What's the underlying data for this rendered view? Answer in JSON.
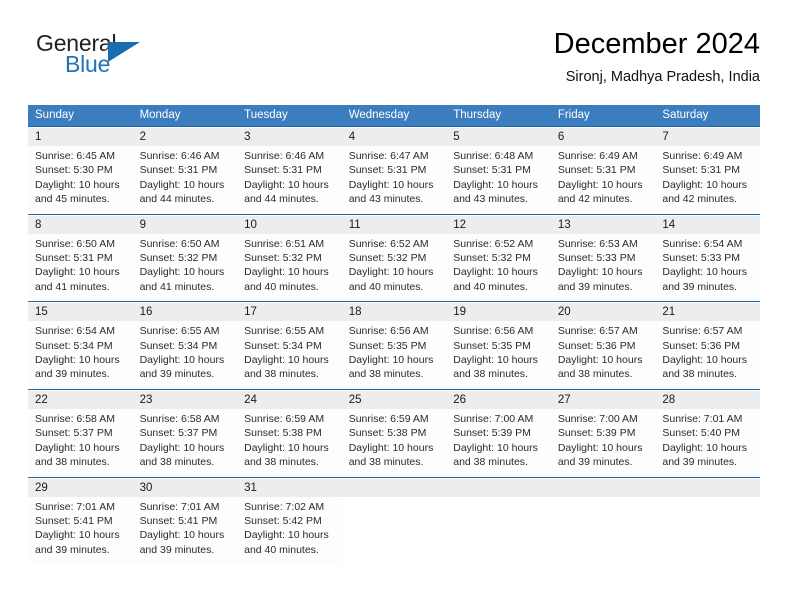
{
  "brand": {
    "line1": "General",
    "line2": "Blue",
    "triangle_color": "#1a6cb0"
  },
  "header": {
    "title": "December 2024",
    "location": "Sironj, Madhya Pradesh, India"
  },
  "theme": {
    "header_bg": "#3b7dbf",
    "separator": "#1d66aa",
    "daynum_bg": "#ededed"
  },
  "weekdays": [
    "Sunday",
    "Monday",
    "Tuesday",
    "Wednesday",
    "Thursday",
    "Friday",
    "Saturday"
  ],
  "labels": {
    "sunrise": "Sunrise:",
    "sunset": "Sunset:",
    "daylight": "Daylight:"
  },
  "weeks": [
    [
      {
        "day": "1",
        "sunrise": "Sunrise: 6:45 AM",
        "sunset": "Sunset: 5:30 PM",
        "daylight": "Daylight: 10 hours and 45 minutes."
      },
      {
        "day": "2",
        "sunrise": "Sunrise: 6:46 AM",
        "sunset": "Sunset: 5:31 PM",
        "daylight": "Daylight: 10 hours and 44 minutes."
      },
      {
        "day": "3",
        "sunrise": "Sunrise: 6:46 AM",
        "sunset": "Sunset: 5:31 PM",
        "daylight": "Daylight: 10 hours and 44 minutes."
      },
      {
        "day": "4",
        "sunrise": "Sunrise: 6:47 AM",
        "sunset": "Sunset: 5:31 PM",
        "daylight": "Daylight: 10 hours and 43 minutes."
      },
      {
        "day": "5",
        "sunrise": "Sunrise: 6:48 AM",
        "sunset": "Sunset: 5:31 PM",
        "daylight": "Daylight: 10 hours and 43 minutes."
      },
      {
        "day": "6",
        "sunrise": "Sunrise: 6:49 AM",
        "sunset": "Sunset: 5:31 PM",
        "daylight": "Daylight: 10 hours and 42 minutes."
      },
      {
        "day": "7",
        "sunrise": "Sunrise: 6:49 AM",
        "sunset": "Sunset: 5:31 PM",
        "daylight": "Daylight: 10 hours and 42 minutes."
      }
    ],
    [
      {
        "day": "8",
        "sunrise": "Sunrise: 6:50 AM",
        "sunset": "Sunset: 5:31 PM",
        "daylight": "Daylight: 10 hours and 41 minutes."
      },
      {
        "day": "9",
        "sunrise": "Sunrise: 6:50 AM",
        "sunset": "Sunset: 5:32 PM",
        "daylight": "Daylight: 10 hours and 41 minutes."
      },
      {
        "day": "10",
        "sunrise": "Sunrise: 6:51 AM",
        "sunset": "Sunset: 5:32 PM",
        "daylight": "Daylight: 10 hours and 40 minutes."
      },
      {
        "day": "11",
        "sunrise": "Sunrise: 6:52 AM",
        "sunset": "Sunset: 5:32 PM",
        "daylight": "Daylight: 10 hours and 40 minutes."
      },
      {
        "day": "12",
        "sunrise": "Sunrise: 6:52 AM",
        "sunset": "Sunset: 5:32 PM",
        "daylight": "Daylight: 10 hours and 40 minutes."
      },
      {
        "day": "13",
        "sunrise": "Sunrise: 6:53 AM",
        "sunset": "Sunset: 5:33 PM",
        "daylight": "Daylight: 10 hours and 39 minutes."
      },
      {
        "day": "14",
        "sunrise": "Sunrise: 6:54 AM",
        "sunset": "Sunset: 5:33 PM",
        "daylight": "Daylight: 10 hours and 39 minutes."
      }
    ],
    [
      {
        "day": "15",
        "sunrise": "Sunrise: 6:54 AM",
        "sunset": "Sunset: 5:34 PM",
        "daylight": "Daylight: 10 hours and 39 minutes."
      },
      {
        "day": "16",
        "sunrise": "Sunrise: 6:55 AM",
        "sunset": "Sunset: 5:34 PM",
        "daylight": "Daylight: 10 hours and 39 minutes."
      },
      {
        "day": "17",
        "sunrise": "Sunrise: 6:55 AM",
        "sunset": "Sunset: 5:34 PM",
        "daylight": "Daylight: 10 hours and 38 minutes."
      },
      {
        "day": "18",
        "sunrise": "Sunrise: 6:56 AM",
        "sunset": "Sunset: 5:35 PM",
        "daylight": "Daylight: 10 hours and 38 minutes."
      },
      {
        "day": "19",
        "sunrise": "Sunrise: 6:56 AM",
        "sunset": "Sunset: 5:35 PM",
        "daylight": "Daylight: 10 hours and 38 minutes."
      },
      {
        "day": "20",
        "sunrise": "Sunrise: 6:57 AM",
        "sunset": "Sunset: 5:36 PM",
        "daylight": "Daylight: 10 hours and 38 minutes."
      },
      {
        "day": "21",
        "sunrise": "Sunrise: 6:57 AM",
        "sunset": "Sunset: 5:36 PM",
        "daylight": "Daylight: 10 hours and 38 minutes."
      }
    ],
    [
      {
        "day": "22",
        "sunrise": "Sunrise: 6:58 AM",
        "sunset": "Sunset: 5:37 PM",
        "daylight": "Daylight: 10 hours and 38 minutes."
      },
      {
        "day": "23",
        "sunrise": "Sunrise: 6:58 AM",
        "sunset": "Sunset: 5:37 PM",
        "daylight": "Daylight: 10 hours and 38 minutes."
      },
      {
        "day": "24",
        "sunrise": "Sunrise: 6:59 AM",
        "sunset": "Sunset: 5:38 PM",
        "daylight": "Daylight: 10 hours and 38 minutes."
      },
      {
        "day": "25",
        "sunrise": "Sunrise: 6:59 AM",
        "sunset": "Sunset: 5:38 PM",
        "daylight": "Daylight: 10 hours and 38 minutes."
      },
      {
        "day": "26",
        "sunrise": "Sunrise: 7:00 AM",
        "sunset": "Sunset: 5:39 PM",
        "daylight": "Daylight: 10 hours and 38 minutes."
      },
      {
        "day": "27",
        "sunrise": "Sunrise: 7:00 AM",
        "sunset": "Sunset: 5:39 PM",
        "daylight": "Daylight: 10 hours and 39 minutes."
      },
      {
        "day": "28",
        "sunrise": "Sunrise: 7:01 AM",
        "sunset": "Sunset: 5:40 PM",
        "daylight": "Daylight: 10 hours and 39 minutes."
      }
    ],
    [
      {
        "day": "29",
        "sunrise": "Sunrise: 7:01 AM",
        "sunset": "Sunset: 5:41 PM",
        "daylight": "Daylight: 10 hours and 39 minutes."
      },
      {
        "day": "30",
        "sunrise": "Sunrise: 7:01 AM",
        "sunset": "Sunset: 5:41 PM",
        "daylight": "Daylight: 10 hours and 39 minutes."
      },
      {
        "day": "31",
        "sunrise": "Sunrise: 7:02 AM",
        "sunset": "Sunset: 5:42 PM",
        "daylight": "Daylight: 10 hours and 40 minutes."
      },
      {
        "day": "",
        "sunrise": "",
        "sunset": "",
        "daylight": ""
      },
      {
        "day": "",
        "sunrise": "",
        "sunset": "",
        "daylight": ""
      },
      {
        "day": "",
        "sunrise": "",
        "sunset": "",
        "daylight": ""
      },
      {
        "day": "",
        "sunrise": "",
        "sunset": "",
        "daylight": ""
      }
    ]
  ]
}
